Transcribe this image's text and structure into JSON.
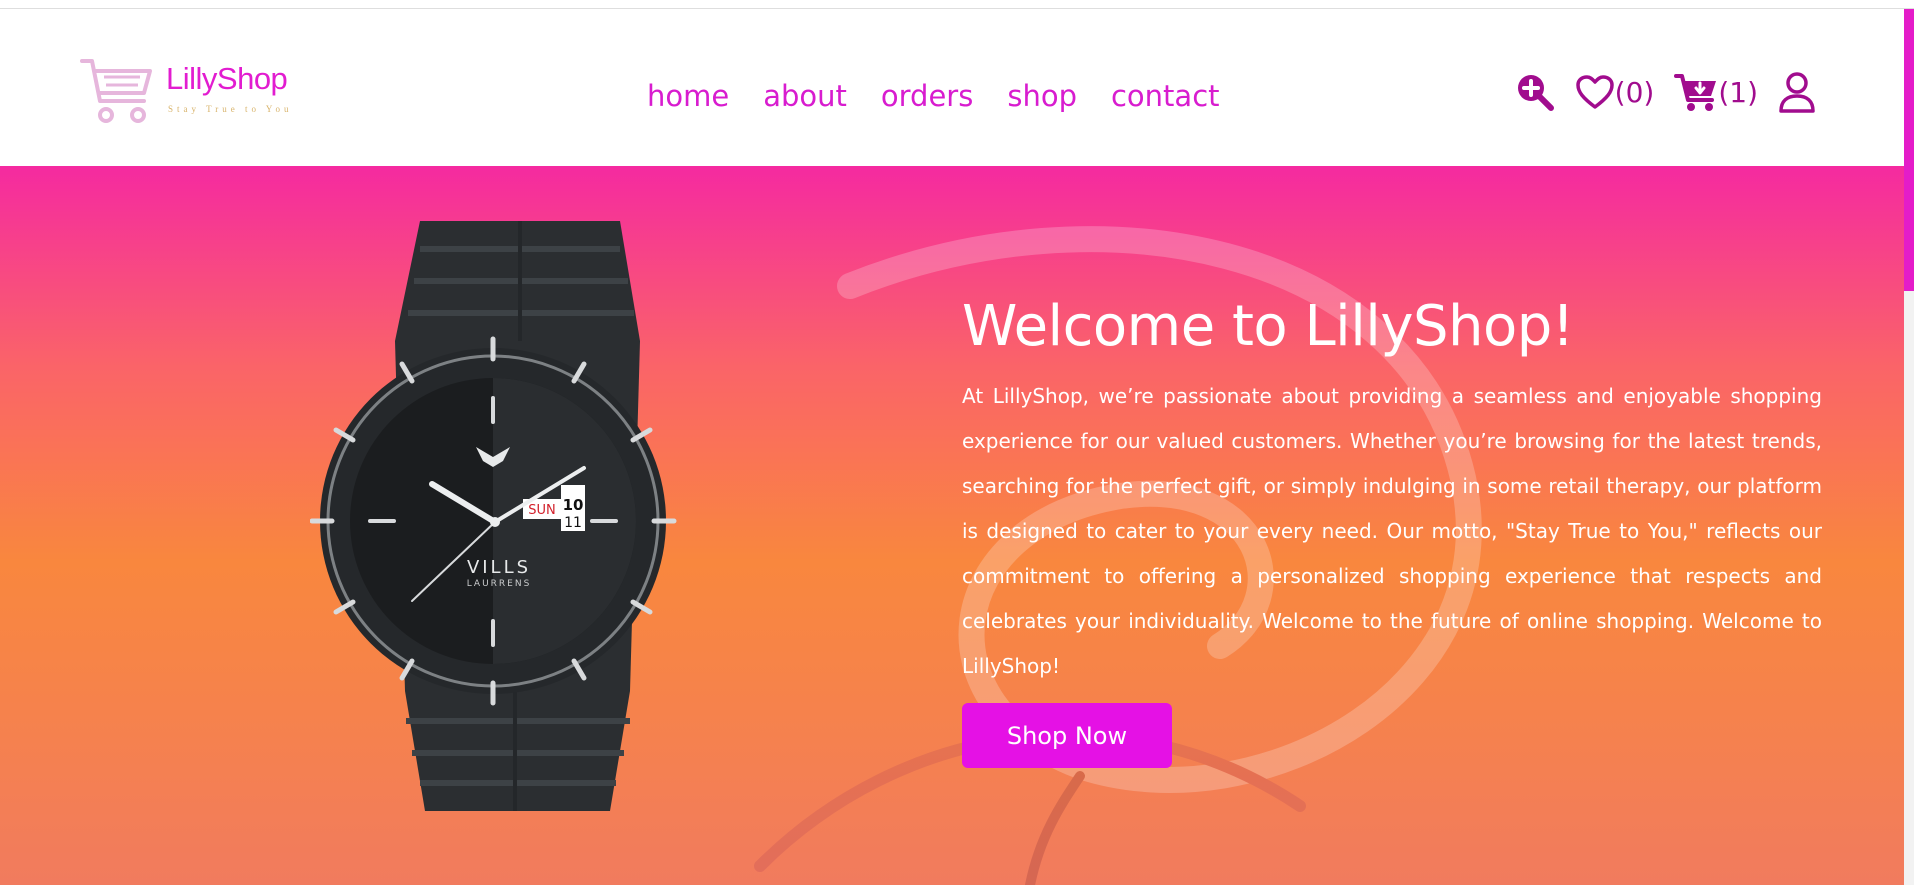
{
  "brand": {
    "name": "LillyShop",
    "tagline": "Stay True to You"
  },
  "nav": {
    "links": [
      "home",
      "about",
      "orders",
      "shop",
      "contact"
    ]
  },
  "header_icons": {
    "search": "search-plus-icon",
    "wishlist_count": "(0)",
    "cart_count": "(1)",
    "user": "user-icon"
  },
  "hero": {
    "title": "Welcome to LillyShop!",
    "text": "At LillyShop, we’re passionate about providing a seamless and enjoyable shopping experience for our valued customers. Whether you’re browsing for the latest trends, searching for the perfect gift, or simply indulging in some retail therapy, our platform is designed to cater to your every need. Our motto, \"Stay True to You,\" reflects our commitment to offering a personalized shopping experience that respects and celebrates your individuality. Welcome to the future of online shopping. Welcome to LillyShop!",
    "button": "Shop Now"
  },
  "product_image": {
    "brand_text": "VILLS",
    "brand_subtext": "LAURRENS",
    "day": "SUN",
    "date": "10",
    "next_date": "11"
  },
  "colors": {
    "accent": "#e21cd0",
    "icon": "#a10c8e",
    "button": "#e511e5",
    "hero_top": "#f52aa0",
    "hero_bottom": "#f17b5e"
  }
}
